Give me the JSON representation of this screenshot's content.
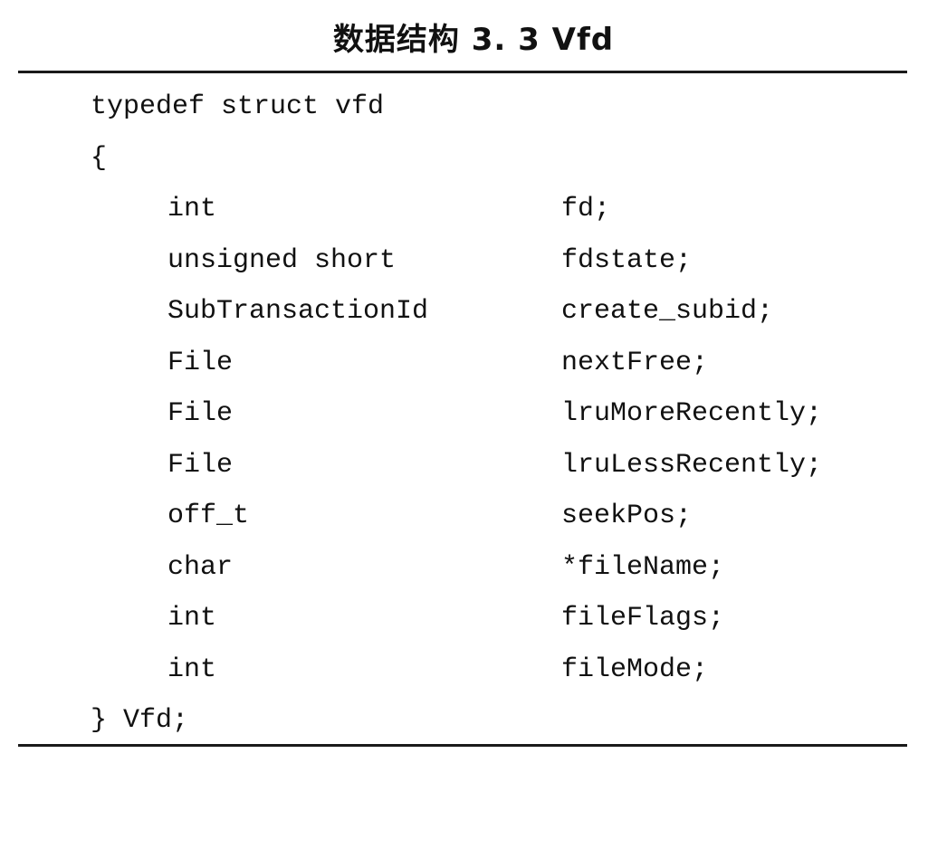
{
  "title": "数据结构 3. 3   Vfd",
  "code": {
    "header": "typedef struct vfd",
    "open_brace": "{",
    "fields": [
      {
        "type": "int",
        "name": "fd;"
      },
      {
        "type": "unsigned short",
        "name": "fdstate;"
      },
      {
        "type": "SubTransactionId",
        "name": "create_subid;"
      },
      {
        "type": "File",
        "name": "nextFree;"
      },
      {
        "type": "File",
        "name": "lruMoreRecently;"
      },
      {
        "type": "File",
        "name": "lruLessRecently;"
      },
      {
        "type": "off_t",
        "name": "seekPos;"
      },
      {
        "type": "char",
        "name": "*fileName;"
      },
      {
        "type": "int",
        "name": "fileFlags;"
      },
      {
        "type": "int",
        "name": "fileMode;"
      }
    ],
    "close": "} Vfd;"
  }
}
